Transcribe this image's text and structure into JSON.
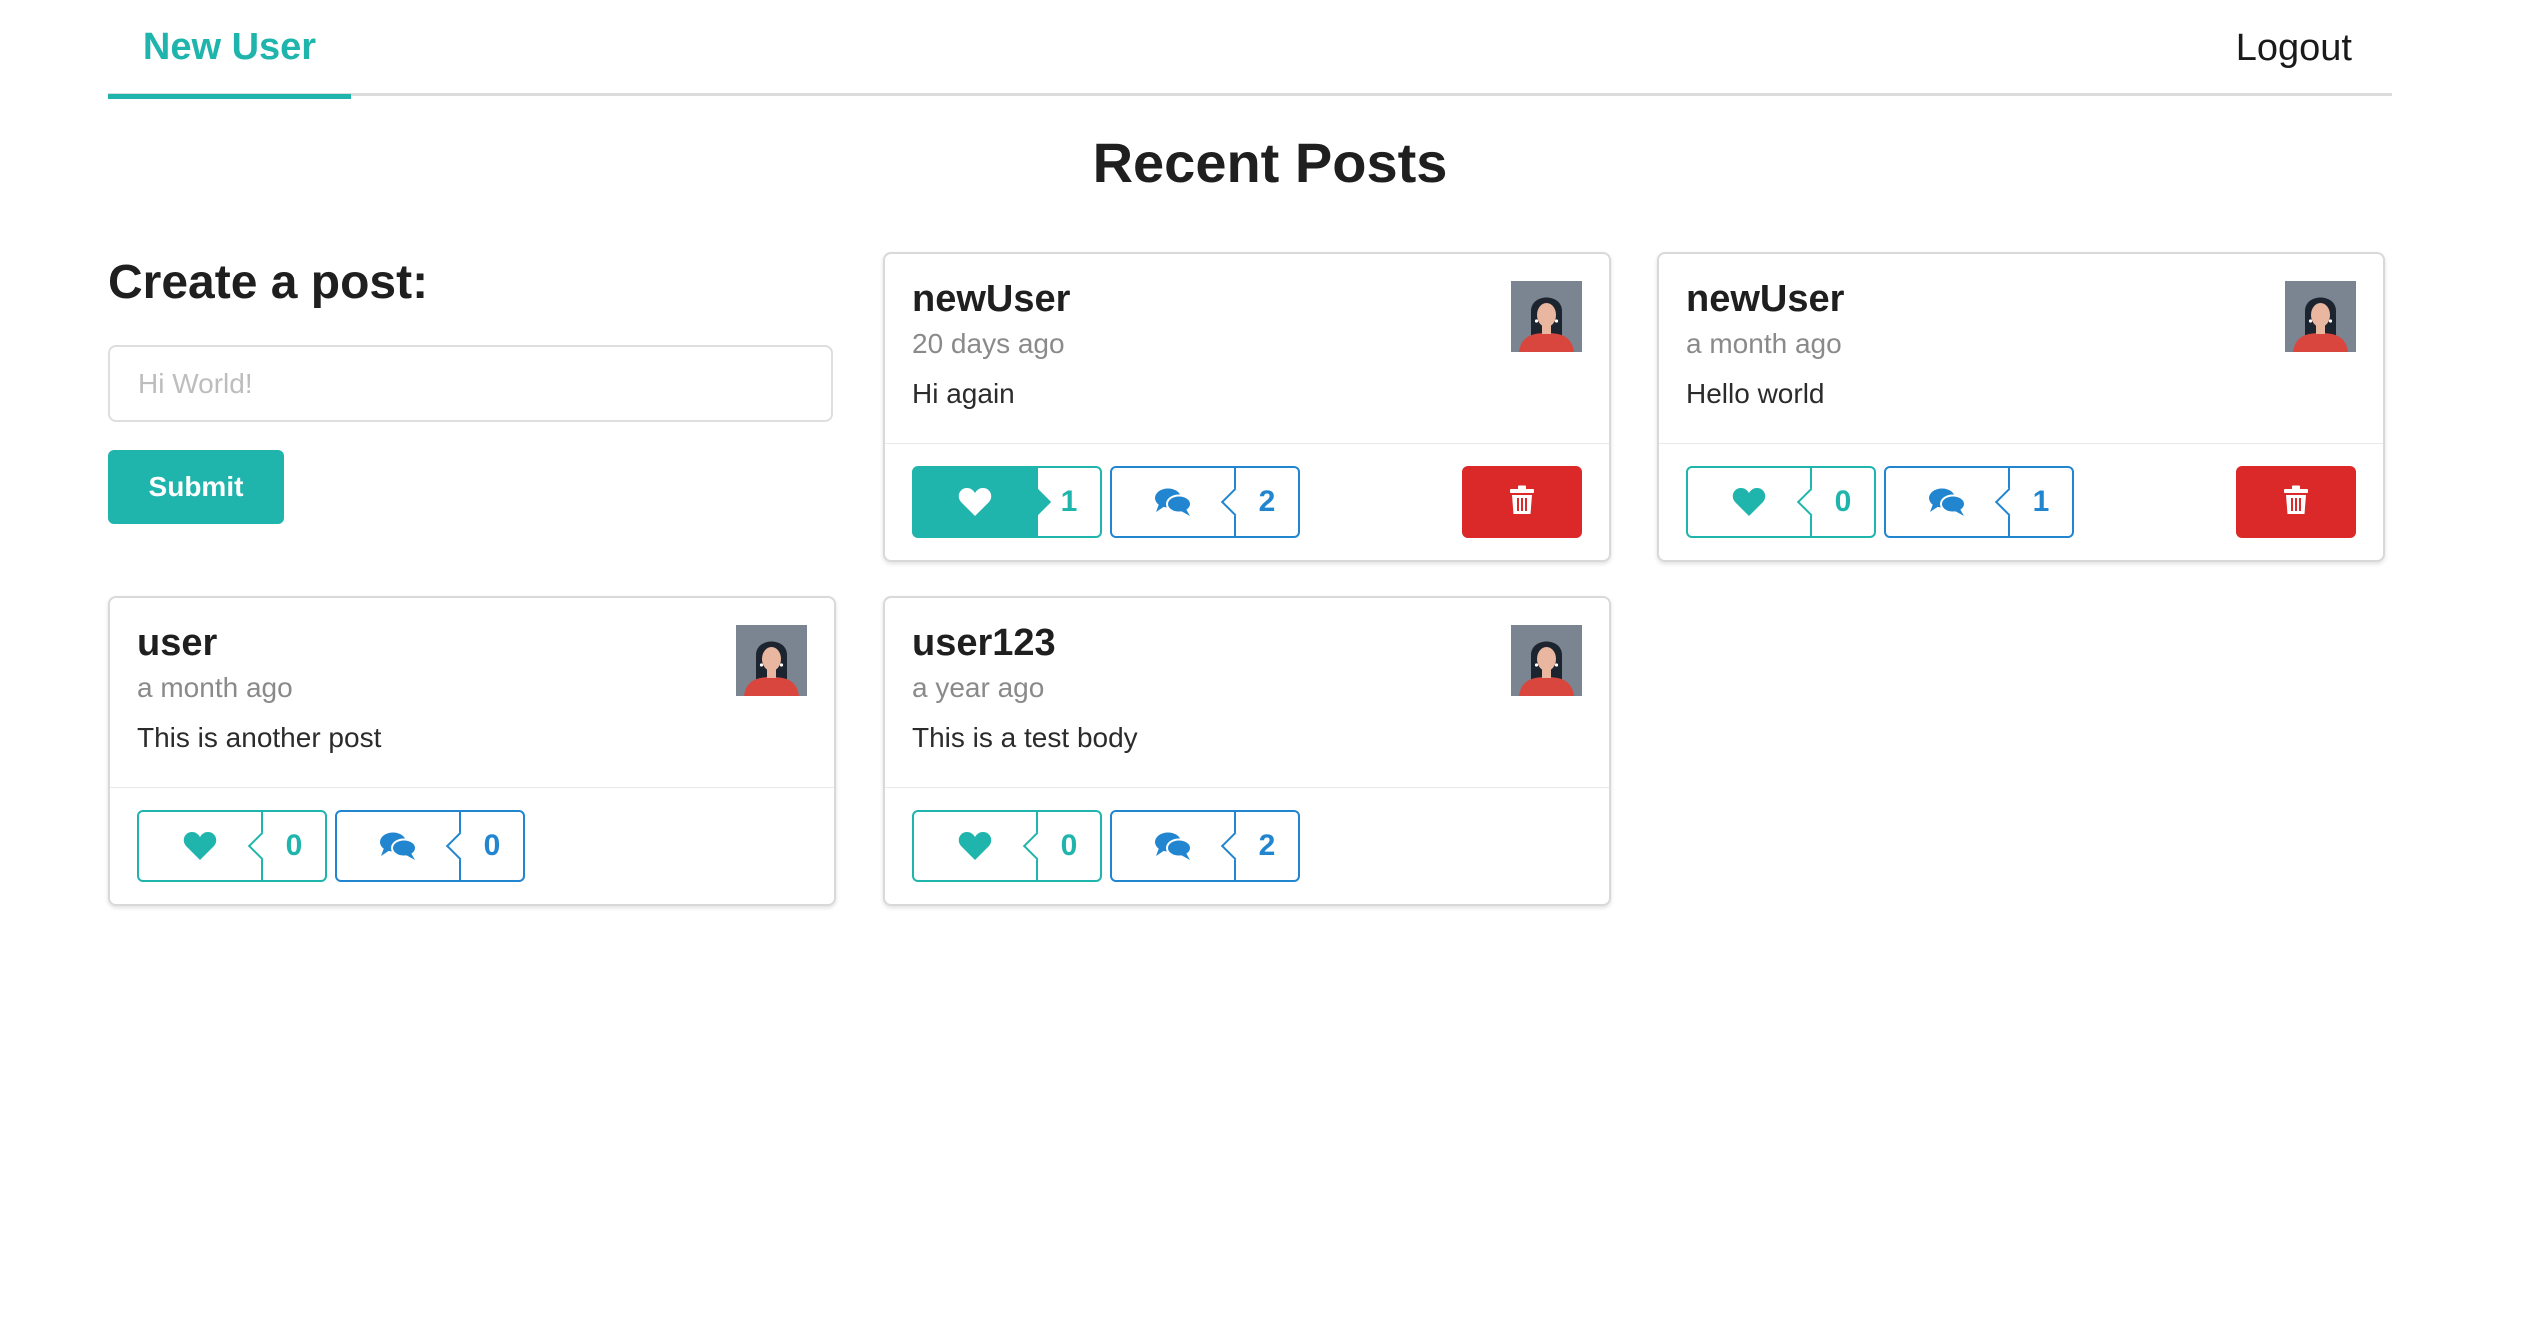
{
  "nav": {
    "active": "New User",
    "logout": "Logout"
  },
  "page_title": "Recent Posts",
  "create": {
    "title": "Create a post:",
    "placeholder": "Hi World!",
    "submit": "Submit"
  },
  "colors": {
    "teal": "#1fb5ad",
    "blue": "#2185d0",
    "red": "#db2828"
  },
  "posts": [
    {
      "user": "newUser",
      "time": "20 days ago",
      "body": "Hi again",
      "likes": "1",
      "comments": "2",
      "liked": true,
      "deletable": true
    },
    {
      "user": "newUser",
      "time": "a month ago",
      "body": "Hello world",
      "likes": "0",
      "comments": "1",
      "liked": false,
      "deletable": true
    },
    {
      "user": "user",
      "time": "a month ago",
      "body": "This is another post",
      "likes": "0",
      "comments": "0",
      "liked": false,
      "deletable": false
    },
    {
      "user": "user123",
      "time": "a year ago",
      "body": "This is a test body",
      "likes": "0",
      "comments": "2",
      "liked": false,
      "deletable": false
    }
  ],
  "icons": {
    "like": "heart-icon",
    "comment": "comments-icon",
    "delete": "trash-icon",
    "avatar": "avatar-image"
  }
}
